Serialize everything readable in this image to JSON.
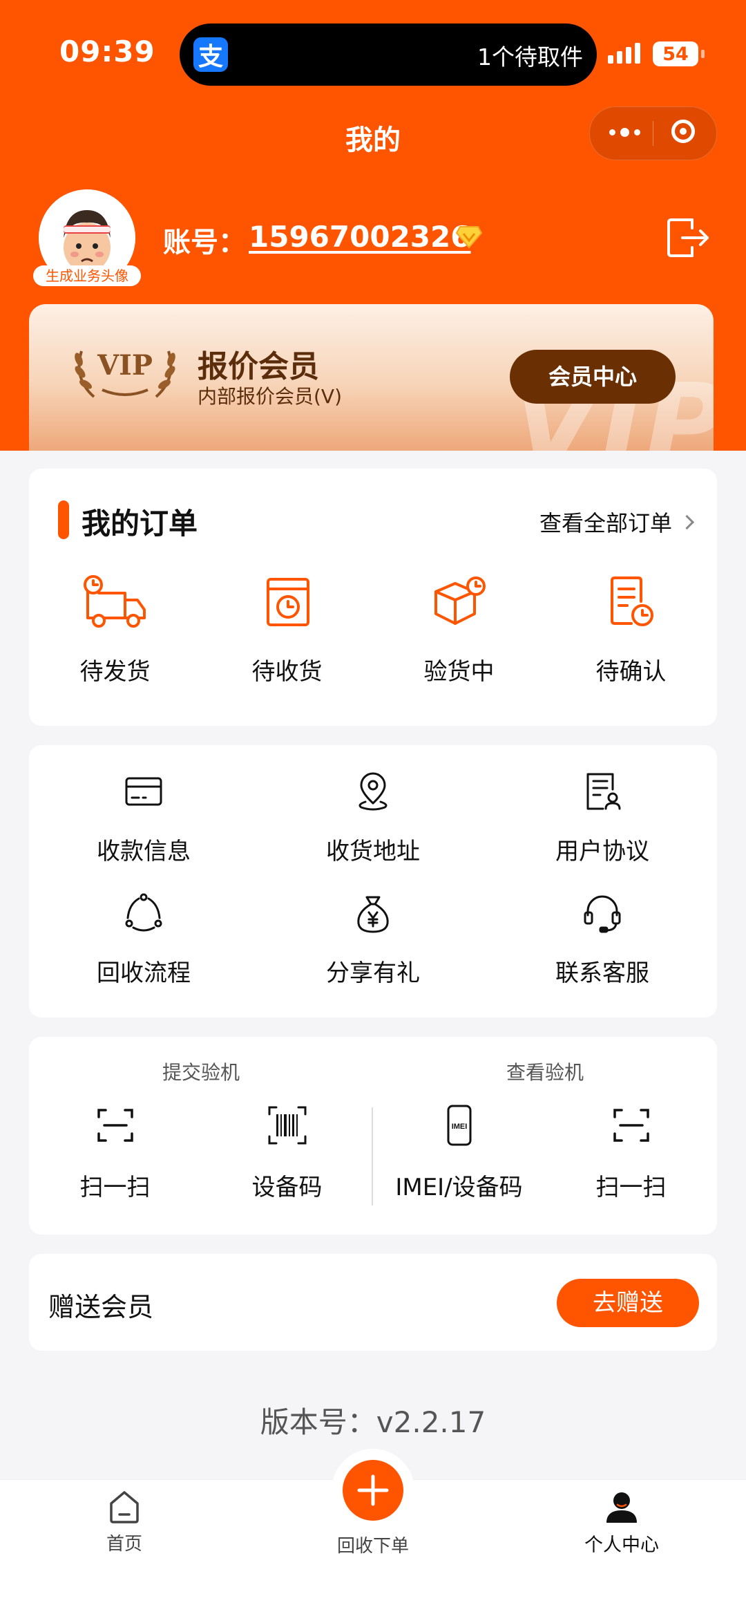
{
  "status_bar": {
    "time": "09:39",
    "notification": "1个待取件",
    "battery": "54",
    "app_badge": "支"
  },
  "nav": {
    "title": "我的"
  },
  "profile": {
    "avatar_tag": "生成业务头像",
    "account_label": "账号：",
    "account_number": "15967002326"
  },
  "vip": {
    "title": "报价会员",
    "subtitle": "内部报价会员(V)",
    "button": "会员中心",
    "watermark": "VIP",
    "laurel_text": "VIP"
  },
  "orders": {
    "title": "我的订单",
    "view_all": "查看全部订单",
    "items": [
      {
        "label": "待发货",
        "icon": "delivery-truck-clock"
      },
      {
        "label": "待收货",
        "icon": "package-clock"
      },
      {
        "label": "验货中",
        "icon": "box-clock"
      },
      {
        "label": "待确认",
        "icon": "document-clock"
      }
    ]
  },
  "services": {
    "items": [
      {
        "label": "收款信息",
        "icon": "card"
      },
      {
        "label": "收货地址",
        "icon": "location-pin"
      },
      {
        "label": "用户协议",
        "icon": "document-user"
      },
      {
        "label": "回收流程",
        "icon": "cycle"
      },
      {
        "label": "分享有礼",
        "icon": "money-bag"
      },
      {
        "label": "联系客服",
        "icon": "headset"
      }
    ]
  },
  "inspect": {
    "submit_title": "提交验机",
    "view_title": "查看验机",
    "items": [
      {
        "label": "扫一扫",
        "icon": "scan"
      },
      {
        "label": "设备码",
        "icon": "barcode"
      },
      {
        "label": "IMEI/设备码",
        "icon": "imei-phone",
        "icon_text": "IMEI"
      },
      {
        "label": "扫一扫",
        "icon": "scan"
      }
    ]
  },
  "gift": {
    "label": "赠送会员",
    "button": "去赠送"
  },
  "version": "版本号：v2.2.17",
  "tabbar": {
    "home": "首页",
    "center": "回收下单",
    "me": "个人中心"
  },
  "colors": {
    "brand": "#ff5500",
    "vip_button": "#6a3003",
    "vip_text": "#5b2d0b",
    "background": "#f5f5f7"
  }
}
